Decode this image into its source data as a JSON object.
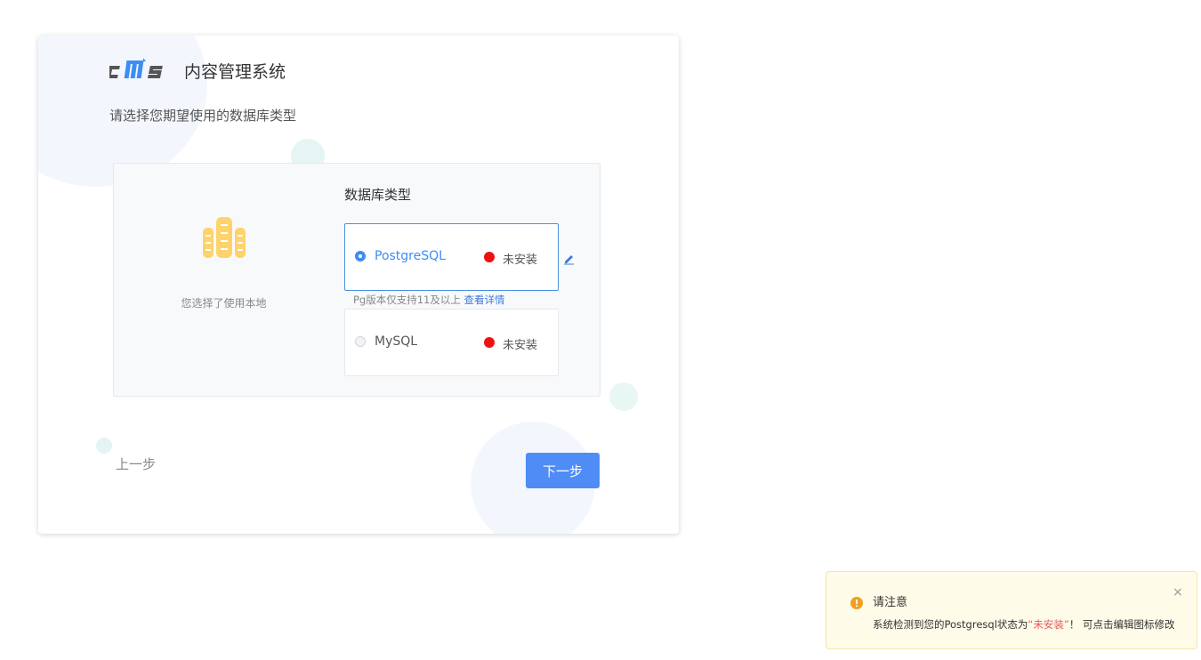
{
  "header": {
    "logo_text": "cms",
    "system_title": "内容管理系统",
    "subtitle": "请选择您期望使用的数据库类型"
  },
  "panel": {
    "local_text": "您选择了使用本地",
    "db_type_label": "数据库类型",
    "options": [
      {
        "label": "PostgreSQL",
        "status": "未安装",
        "selected": true
      },
      {
        "label": "MySQL",
        "status": "未安装",
        "selected": false
      }
    ],
    "version_note": "Pg版本仅支持11及以上",
    "view_details": "查看详情"
  },
  "buttons": {
    "prev": "上一步",
    "next": "下一步"
  },
  "notice": {
    "title": "请注意",
    "body_prefix": "系统检测到您的Postgresql状态为",
    "body_highlight": "“未安装”",
    "body_suffix": "！ 可点击编辑图标修改",
    "close": "×"
  },
  "colors": {
    "accent": "#3d8df5",
    "button": "#4f8cf6",
    "status_not_installed": "#ee1111",
    "warning": "#f0a020"
  },
  "icons": {
    "logo": "cms-logo-icon",
    "database_illustration": "database-icon",
    "edit": "pencil-icon",
    "warning": "warning-icon",
    "close": "close-icon"
  }
}
